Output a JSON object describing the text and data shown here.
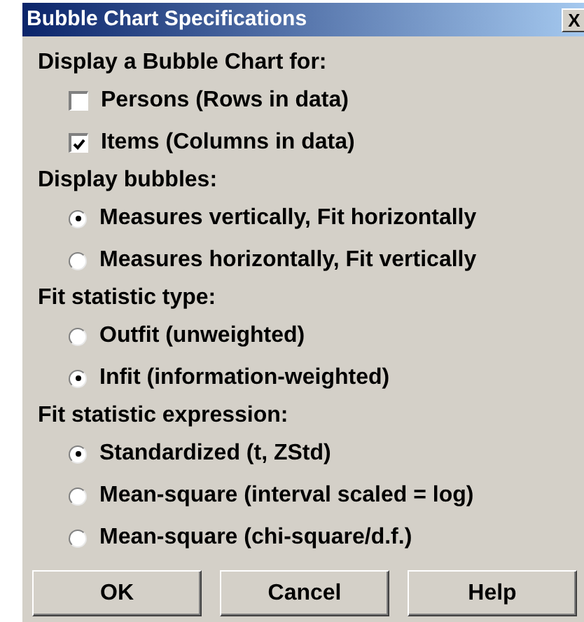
{
  "window": {
    "title": "Bubble Chart Specifications",
    "close": "X"
  },
  "sections": [
    {
      "heading": "Display a Bubble Chart for:",
      "options": [
        {
          "kind": "checkbox",
          "label": "Persons (Rows in data)",
          "checked": false
        },
        {
          "kind": "checkbox",
          "label": "Items (Columns in data)",
          "checked": true
        }
      ]
    },
    {
      "heading": "Display bubbles:",
      "options": [
        {
          "kind": "radio",
          "label": "Measures vertically, Fit horizontally",
          "selected": true
        },
        {
          "kind": "radio",
          "label": "Measures horizontally, Fit vertically",
          "selected": false
        }
      ]
    },
    {
      "heading": "Fit statistic type:",
      "options": [
        {
          "kind": "radio",
          "label": "Outfit (unweighted)",
          "selected": false
        },
        {
          "kind": "radio",
          "label": "Infit (information-weighted)",
          "selected": true
        }
      ]
    },
    {
      "heading": "Fit statistic expression:",
      "options": [
        {
          "kind": "radio",
          "label": "Standardized (t, ZStd)",
          "selected": true
        },
        {
          "kind": "radio",
          "label": "Mean-square (interval scaled = log)",
          "selected": false
        },
        {
          "kind": "radio",
          "label": "Mean-square (chi-square/d.f.)",
          "selected": false
        }
      ]
    }
  ],
  "buttons": [
    "OK",
    "Cancel",
    "Help"
  ]
}
